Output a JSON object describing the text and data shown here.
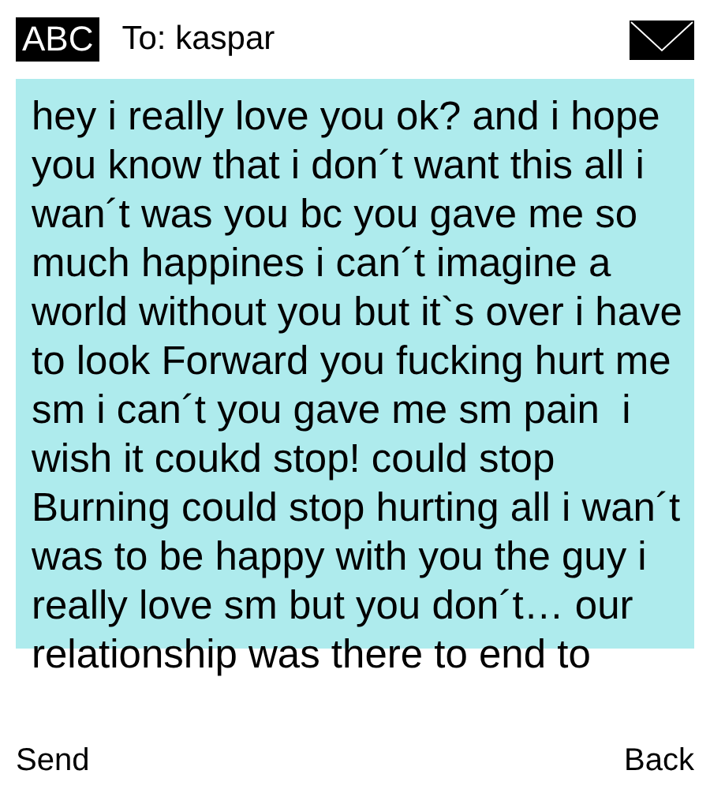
{
  "header": {
    "input_mode": "ABC",
    "recipient": "To: kaspar"
  },
  "message": {
    "text": "hey i really love you ok? and i hope you know that i don´t want this all i wan´t was you bc you gave me so much happines i can´t imagine a world without you but it`s over i have to look Forward you fucking hurt me sm i can´t you gave me sm pain  i wish it coukd stop! could stop Burning could stop hurting all i wan´t was to be happy with you the guy i really love sm but you don´t… our relationship was there to end to"
  },
  "softkeys": {
    "left": "Send",
    "right": "Back"
  }
}
